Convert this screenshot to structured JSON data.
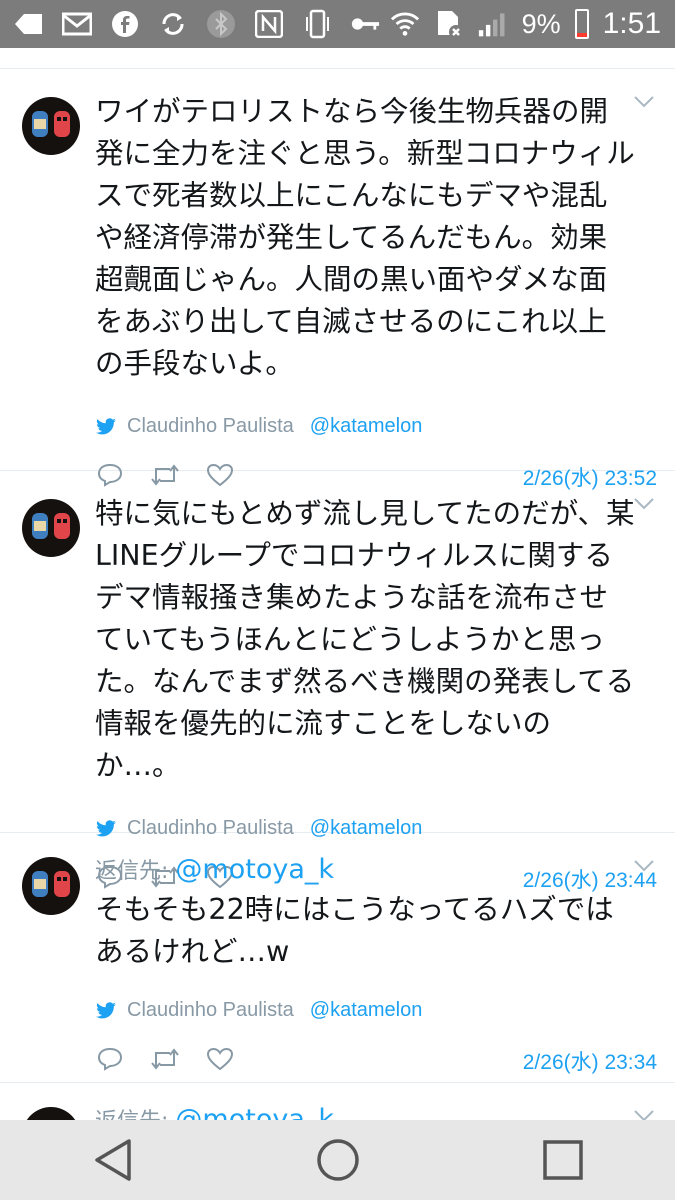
{
  "status_bar": {
    "battery": "9%",
    "time": "1:51",
    "icons": [
      "back-arrow-icon",
      "gmail-icon",
      "facebook-icon",
      "sync-icon",
      "bluetooth-icon",
      "nfc-icon",
      "phone-vibrate-icon",
      "key-icon",
      "wifi-icon",
      "sim-alert-icon",
      "signal-icon",
      "battery-icon"
    ]
  },
  "tweets": [
    {
      "reply_label": "",
      "reply_handle": "",
      "text": "ワイがテロリストなら今後生物兵器の開発に全力を注ぐと思う。新型コロナウィルスで死者数以上にこんなにもデマや混乱や経済停滞が発生してるんだもん。効果超覿面じゃん。人間の黒い面やダメな面をあぶり出して自滅させるのにこれ以上の手段ないよ。",
      "author": "Claudinho Paulista",
      "handle": "@katamelon",
      "timestamp": "2/26(水) 23:52"
    },
    {
      "reply_label": "",
      "reply_handle": "",
      "text": "特に気にもとめず流し見してたのだが、某LINEグループでコロナウィルスに関するデマ情報掻き集めたような話を流布させていてもうほんとにどうしようかと思った。なんでまず然るべき機関の発表してる情報を優先的に流すことをしないのか…。",
      "author": "Claudinho Paulista",
      "handle": "@katamelon",
      "timestamp": "2/26(水) 23:44"
    },
    {
      "reply_label": "返信先:",
      "reply_handle": "@motoya_k",
      "text": "そもそも22時にはこうなってるハズではあるけれど…w",
      "author": "Claudinho Paulista",
      "handle": "@katamelon",
      "timestamp": "2/26(水) 23:34"
    },
    {
      "reply_label": "返信先:",
      "reply_handle": "@motoya_k",
      "text": "",
      "author": "",
      "handle": "",
      "timestamp": ""
    }
  ],
  "colors": {
    "accent": "#1da1f2",
    "secondary_text": "#8899a6",
    "status_bar": "#7c7c7c",
    "nav_bar": "#e7e7e7"
  },
  "nav": {
    "icons": [
      "back-triangle-icon",
      "home-circle-icon",
      "recents-square-icon"
    ]
  }
}
